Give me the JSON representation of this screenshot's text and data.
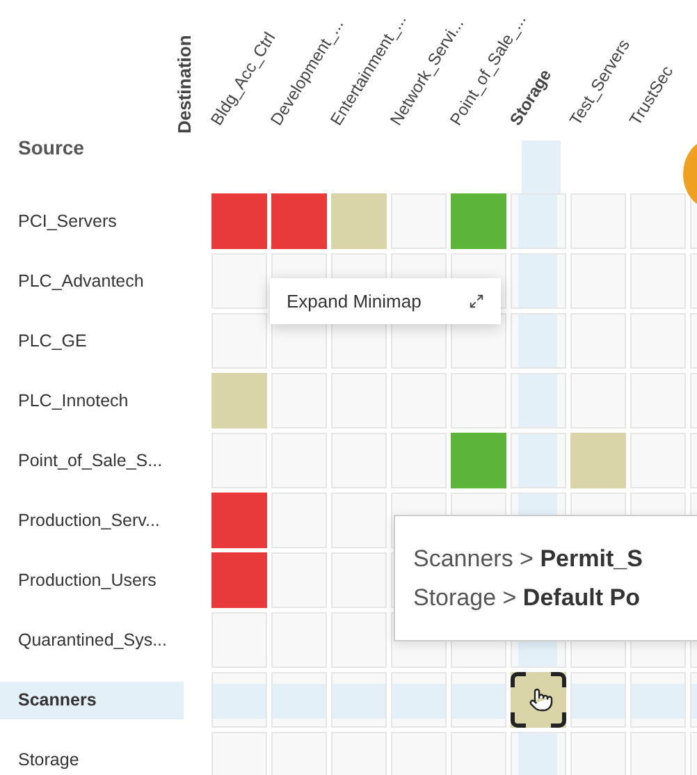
{
  "source_label": "Source",
  "destination_label": "Destination",
  "columns": [
    {
      "label": "Bldg_Acc_Ctrl",
      "selected": false
    },
    {
      "label": "Development_...",
      "selected": false
    },
    {
      "label": "Entertainment_...",
      "selected": false
    },
    {
      "label": "Network_Servi...",
      "selected": false
    },
    {
      "label": "Point_of_Sale_...",
      "selected": false
    },
    {
      "label": "Storage",
      "selected": true
    },
    {
      "label": "Test_Servers",
      "selected": false
    },
    {
      "label": "TrustSec",
      "selected": false
    }
  ],
  "rows": [
    {
      "label": "PCI_Servers",
      "selected": false,
      "cells": [
        {
          "kind": "deny",
          "focused": false
        },
        {
          "kind": "deny",
          "focused": false
        },
        {
          "kind": "default",
          "focused": false
        },
        {
          "kind": "empty",
          "focused": false
        },
        {
          "kind": "permit",
          "focused": false
        },
        {
          "kind": "empty",
          "focused": false
        },
        {
          "kind": "empty",
          "focused": false
        },
        {
          "kind": "empty",
          "focused": false
        },
        {
          "kind": "empty",
          "focused": false
        }
      ]
    },
    {
      "label": "PLC_Advantech",
      "selected": false,
      "cells": [
        {
          "kind": "empty",
          "focused": false
        },
        {
          "kind": "empty",
          "focused": false
        },
        {
          "kind": "empty",
          "focused": false
        },
        {
          "kind": "empty",
          "focused": false
        },
        {
          "kind": "empty",
          "focused": false
        },
        {
          "kind": "empty",
          "focused": false
        },
        {
          "kind": "empty",
          "focused": false
        },
        {
          "kind": "empty",
          "focused": false
        },
        {
          "kind": "empty",
          "focused": false
        }
      ]
    },
    {
      "label": "PLC_GE",
      "selected": false,
      "cells": [
        {
          "kind": "empty",
          "focused": false
        },
        {
          "kind": "empty",
          "focused": false
        },
        {
          "kind": "empty",
          "focused": false
        },
        {
          "kind": "empty",
          "focused": false
        },
        {
          "kind": "empty",
          "focused": false
        },
        {
          "kind": "empty",
          "focused": false
        },
        {
          "kind": "empty",
          "focused": false
        },
        {
          "kind": "empty",
          "focused": false
        },
        {
          "kind": "empty",
          "focused": false
        }
      ]
    },
    {
      "label": "PLC_Innotech",
      "selected": false,
      "cells": [
        {
          "kind": "default",
          "focused": false
        },
        {
          "kind": "empty",
          "focused": false
        },
        {
          "kind": "empty",
          "focused": false
        },
        {
          "kind": "empty",
          "focused": false
        },
        {
          "kind": "empty",
          "focused": false
        },
        {
          "kind": "empty",
          "focused": false
        },
        {
          "kind": "empty",
          "focused": false
        },
        {
          "kind": "empty",
          "focused": false
        },
        {
          "kind": "empty",
          "focused": false
        }
      ]
    },
    {
      "label": "Point_of_Sale_S...",
      "selected": false,
      "cells": [
        {
          "kind": "empty",
          "focused": false
        },
        {
          "kind": "empty",
          "focused": false
        },
        {
          "kind": "empty",
          "focused": false
        },
        {
          "kind": "empty",
          "focused": false
        },
        {
          "kind": "permit",
          "focused": false
        },
        {
          "kind": "empty",
          "focused": false
        },
        {
          "kind": "default",
          "focused": false
        },
        {
          "kind": "empty",
          "focused": false
        },
        {
          "kind": "empty",
          "focused": false
        }
      ]
    },
    {
      "label": "Production_Serv...",
      "selected": false,
      "cells": [
        {
          "kind": "deny",
          "focused": false
        },
        {
          "kind": "empty",
          "focused": false
        },
        {
          "kind": "empty",
          "focused": false
        },
        {
          "kind": "empty",
          "focused": false
        },
        {
          "kind": "empty",
          "focused": false
        },
        {
          "kind": "empty",
          "focused": false
        },
        {
          "kind": "empty",
          "focused": false
        },
        {
          "kind": "empty",
          "focused": false
        },
        {
          "kind": "empty",
          "focused": false
        }
      ]
    },
    {
      "label": "Production_Users",
      "selected": false,
      "cells": [
        {
          "kind": "deny",
          "focused": false
        },
        {
          "kind": "empty",
          "focused": false
        },
        {
          "kind": "empty",
          "focused": false
        },
        {
          "kind": "empty",
          "focused": false
        }
      ]
    },
    {
      "label": "Quarantined_Sys...",
      "selected": false,
      "cells": [
        {
          "kind": "empty",
          "focused": false
        },
        {
          "kind": "empty",
          "focused": false
        },
        {
          "kind": "empty",
          "focused": false
        },
        {
          "kind": "empty",
          "focused": false
        },
        {
          "kind": "empty",
          "focused": false
        },
        {
          "kind": "empty",
          "focused": false
        },
        {
          "kind": "empty",
          "focused": false
        },
        {
          "kind": "empty",
          "focused": false
        },
        {
          "kind": "empty",
          "focused": false
        }
      ]
    },
    {
      "label": "Scanners",
      "selected": true,
      "cells": [
        {
          "kind": "empty",
          "focused": false
        },
        {
          "kind": "empty",
          "focused": false
        },
        {
          "kind": "empty",
          "focused": false
        },
        {
          "kind": "empty",
          "focused": false
        },
        {
          "kind": "empty",
          "focused": false
        },
        {
          "kind": "default",
          "focused": true
        },
        {
          "kind": "empty",
          "focused": false
        },
        {
          "kind": "empty",
          "focused": false
        },
        {
          "kind": "empty",
          "focused": false
        }
      ]
    },
    {
      "label": "Storage",
      "selected": false,
      "cells": [
        {
          "kind": "empty",
          "focused": false
        },
        {
          "kind": "empty",
          "focused": false
        },
        {
          "kind": "empty",
          "focused": false
        },
        {
          "kind": "empty",
          "focused": false
        },
        {
          "kind": "empty",
          "focused": false
        },
        {
          "kind": "empty",
          "focused": false
        },
        {
          "kind": "empty",
          "focused": false
        },
        {
          "kind": "empty",
          "focused": false
        },
        {
          "kind": "empty",
          "focused": false
        }
      ]
    }
  ],
  "minimap_tooltip": {
    "label": "Expand Minimap"
  },
  "policy_tooltip": {
    "lines": [
      "Scanners > **Permit_S**",
      "Storage > **Default Po**"
    ]
  }
}
